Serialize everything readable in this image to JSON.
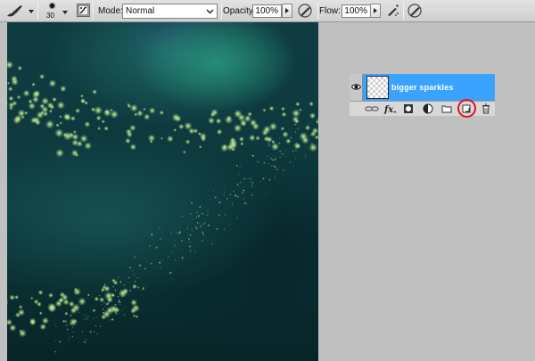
{
  "options_bar": {
    "brush_size": "30",
    "mode_label": "Mode:",
    "mode_value": "Normal",
    "opacity_label": "Opacity:",
    "opacity_value": "100%",
    "flow_label": "Flow:",
    "flow_value": "100%",
    "icons": [
      "brush-tool-icon",
      "brush-preset-icon",
      "toggle-brush-panel-icon",
      "tablet-pressure-opacity-icon",
      "airbrush-icon",
      "tablet-pressure-size-icon"
    ]
  },
  "canvas": {
    "description_colors": {
      "base": "#0d3a3d",
      "glow": "#2a9682",
      "sparkle": "#b9e28a"
    }
  },
  "layers_panel": {
    "layer_name": "bigger sparkles",
    "selected_color": "#3aa3ff",
    "toolbar_icons": [
      "link-layers-icon",
      "layer-style-fx-icon",
      "layer-mask-icon",
      "adjustment-layer-icon",
      "new-group-icon",
      "new-layer-icon",
      "delete-layer-icon"
    ],
    "highlight_color": "#e8101a"
  }
}
